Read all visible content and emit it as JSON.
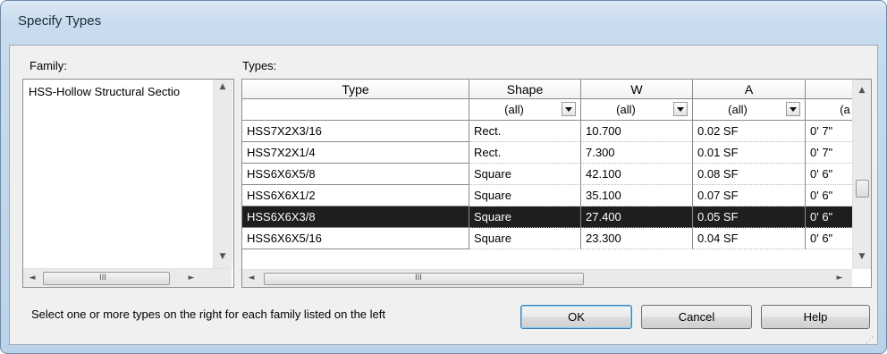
{
  "window": {
    "title": "Specify Types"
  },
  "family": {
    "label": "Family:",
    "items": [
      {
        "label": "HSS-Hollow Structural Sectio"
      }
    ]
  },
  "types": {
    "label": "Types:",
    "columns": [
      {
        "header": "Type",
        "filter": ""
      },
      {
        "header": "Shape",
        "filter": "(all)"
      },
      {
        "header": "W",
        "filter": "(all)"
      },
      {
        "header": "A",
        "filter": "(all)"
      },
      {
        "header": "",
        "filter": "(a"
      }
    ],
    "rows": [
      {
        "type": "HSS7X2X3/16",
        "shape": "Rect.",
        "w": "10.700",
        "a": "0.02 SF",
        "extra": "0'  7\"",
        "selected": false
      },
      {
        "type": "HSS7X2X1/4",
        "shape": "Rect.",
        "w": "7.300",
        "a": "0.01 SF",
        "extra": "0'  7\"",
        "selected": false
      },
      {
        "type": "HSS6X6X5/8",
        "shape": "Square",
        "w": "42.100",
        "a": "0.08 SF",
        "extra": "0'  6\"",
        "selected": false
      },
      {
        "type": "HSS6X6X1/2",
        "shape": "Square",
        "w": "35.100",
        "a": "0.07 SF",
        "extra": "0'  6\"",
        "selected": false
      },
      {
        "type": "HSS6X6X3/8",
        "shape": "Square",
        "w": "27.400",
        "a": "0.05 SF",
        "extra": "0'  6\"",
        "selected": true
      },
      {
        "type": "HSS6X6X5/16",
        "shape": "Square",
        "w": "23.300",
        "a": "0.04 SF",
        "extra": "0'  6\"",
        "selected": false
      }
    ]
  },
  "hint": "Select one or more types on the right for each family listed on the left",
  "buttons": {
    "ok": "OK",
    "cancel": "Cancel",
    "help": "Help"
  },
  "icons": {
    "up": "▲",
    "down": "▼",
    "left": "◄",
    "right": "►",
    "grip": "III"
  },
  "colors": {
    "selection": "#1e1e1e",
    "default_button_border": "#3c7fb1"
  }
}
